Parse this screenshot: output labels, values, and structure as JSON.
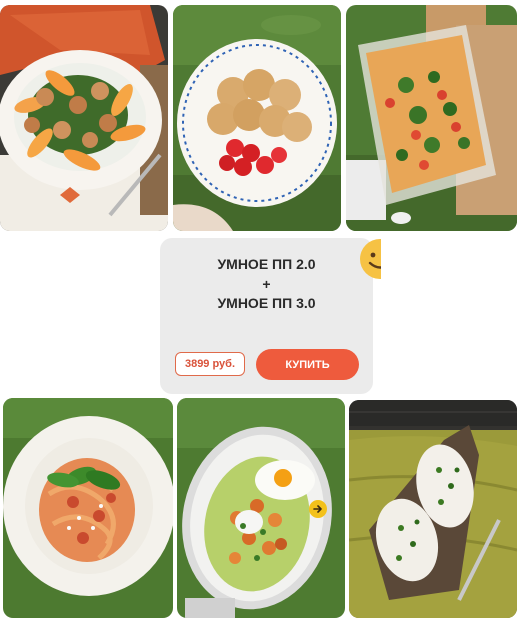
{
  "product_card": {
    "title_line_1": "УМНОЕ ПП 2.0",
    "title_plus": "+",
    "title_line_2": "УМНОЕ ПП 3.0",
    "price": "3899 руб.",
    "buy_label": "КУПИТЬ"
  },
  "photos": [
    {
      "icon": "shrimp-peach-salad-photo"
    },
    {
      "icon": "pancakes-strawberries-photo"
    },
    {
      "icon": "vegetable-casserole-photo"
    },
    {
      "icon": "pasta-basil-photo"
    },
    {
      "icon": "egg-vegetable-bowl-photo"
    },
    {
      "icon": "toast-herbs-photo"
    }
  ],
  "colors": {
    "accent": "#ee5b3d",
    "price_text": "#d9523a",
    "card_bg": "#ebebeb",
    "title_text": "#2a2a2a",
    "smiley": "#f6c244",
    "arrow_button": "#f3c11a"
  }
}
